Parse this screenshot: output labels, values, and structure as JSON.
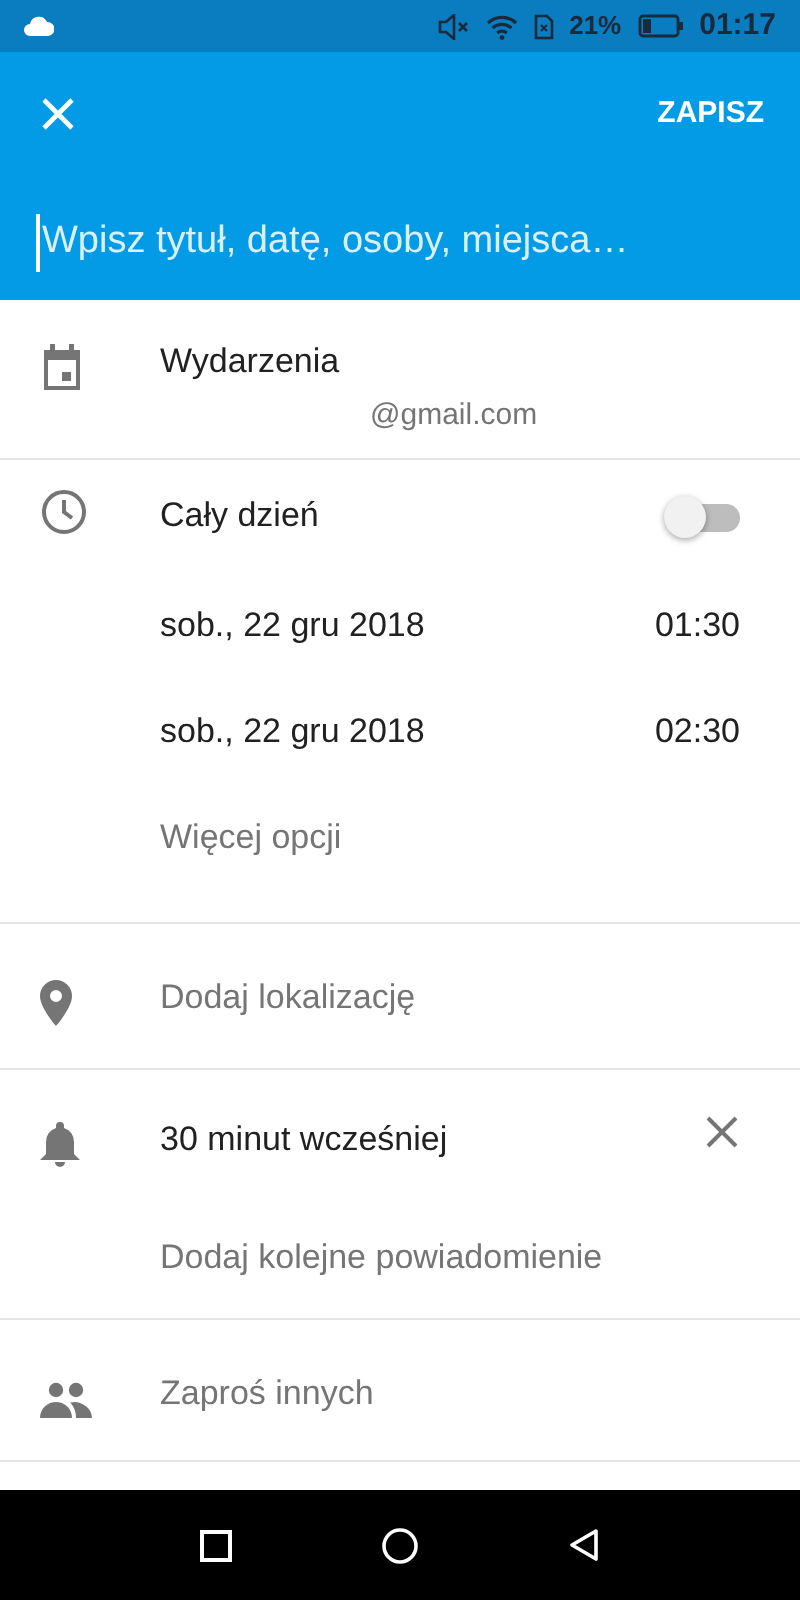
{
  "status_bar": {
    "battery_percent": "21%",
    "time": "01:17"
  },
  "toolbar": {
    "action": "ZAPISZ"
  },
  "title_field": {
    "placeholder": "Wpisz tytuł, datę, osoby, miejsca…"
  },
  "calendar": {
    "name": "Wydarzenia",
    "account": "@gmail.com"
  },
  "time": {
    "all_day_label": "Cały dzień",
    "all_day": false,
    "start": {
      "date": "sob., 22 gru 2018",
      "time": "01:30"
    },
    "end": {
      "date": "sob., 22 gru 2018",
      "time": "02:30"
    },
    "more": "Więcej opcji"
  },
  "location": {
    "placeholder": "Dodaj lokalizację"
  },
  "notifications": {
    "items": [
      "30 minut wcześniej"
    ],
    "add": "Dodaj kolejne powiadomienie"
  },
  "guests": {
    "placeholder": "Zaproś innych"
  }
}
